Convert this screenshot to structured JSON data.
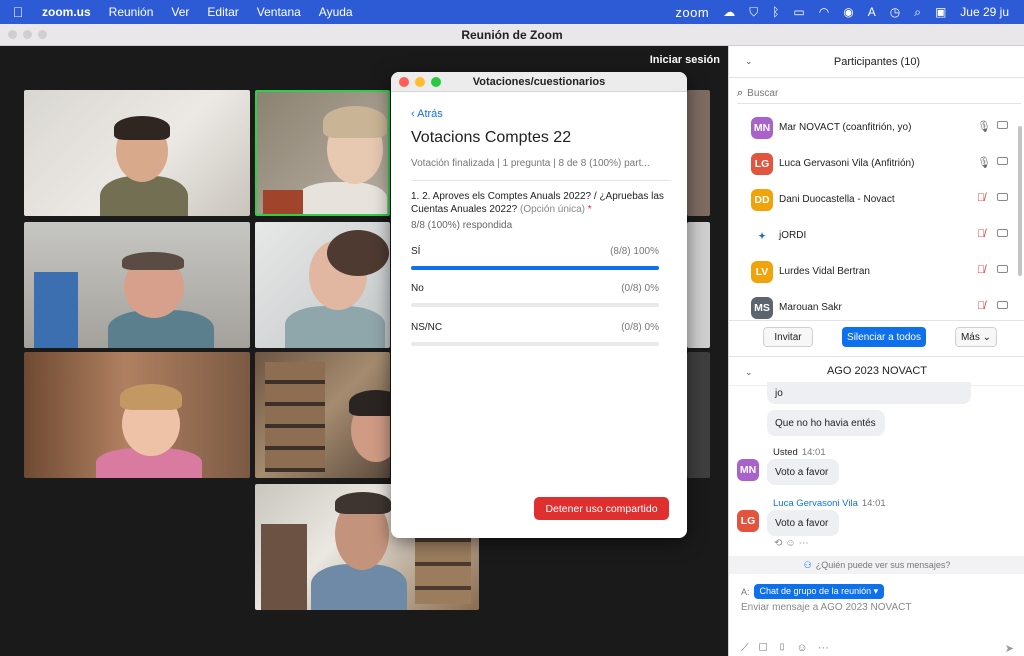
{
  "menubar": {
    "app": "zoom.us",
    "items": [
      "Reunión",
      "Ver",
      "Editar",
      "Ventana",
      "Ayuda"
    ],
    "status_zoom": "zoom",
    "clock": "Jue 29 ju"
  },
  "window": {
    "title": "Reunión de Zoom",
    "signin": "Iniciar sesión"
  },
  "poll": {
    "window_title": "Votaciones/cuestionarios",
    "back": "‹ Atrás",
    "name": "Votacions Comptes 22",
    "meta": "Votación finalizada  |  1 pregunta  |  8 de 8 (100%) part...",
    "question": "1. 2. Aproves els Comptes Anuals 2022? / ¿Apruebas las Cuentas Anuales 2022?",
    "question_type": "(Opción única)",
    "required_mark": "*",
    "answered": "8/8 (100%) respondida",
    "options": [
      {
        "label": "SÍ",
        "result": "(8/8) 100%",
        "fraction": 1.0
      },
      {
        "label": "No",
        "result": "(0/8) 0%",
        "fraction": 0.0
      },
      {
        "label": "NS/NC",
        "result": "(0/8) 0%",
        "fraction": 0.0
      }
    ],
    "stop_button": "Detener uso compartido"
  },
  "participants": {
    "header": "Participantes (10)",
    "search_placeholder": "Buscar",
    "list": [
      {
        "initials": "MN",
        "name": "Mar NOVACT (coanfitrión, yo)",
        "color": "#a862c9",
        "muted": false
      },
      {
        "initials": "LG",
        "name": "Luca Gervasoni Vila (Anfitrión)",
        "color": "#e2543e",
        "muted": false
      },
      {
        "initials": "DD",
        "name": "Dani Duocastella - Novact",
        "color": "#f0a30a",
        "muted": true
      },
      {
        "initials": "",
        "name": "jORDI",
        "color": "#ffffff",
        "muted": true
      },
      {
        "initials": "LV",
        "name": "Lurdes Vidal Bertran",
        "color": "#f0a30a",
        "muted": true
      },
      {
        "initials": "MS",
        "name": "Marouan Sakr",
        "color": "#5c6470",
        "muted": true
      }
    ],
    "invite": "Invitar",
    "mute_all": "Silenciar a todos",
    "more": "Más ⌄"
  },
  "chat": {
    "header": "AGO 2023 NOVACT",
    "msg_top": "jo",
    "msg_prev": "Que no ho havia entés",
    "msg1": {
      "sender": "Usted",
      "time": "14:01",
      "text": "Voto a favor",
      "initials": "MN",
      "color": "#a862c9"
    },
    "msg2": {
      "sender": "Luca Gervasoni Vila",
      "time": "14:01",
      "text": "Voto a favor",
      "initials": "LG",
      "color": "#e2543e"
    },
    "privacy": "¿Quién puede ver sus mensajes?",
    "to_label": "A:",
    "to_value": "Chat de grupo de la reunión ▾",
    "input_placeholder": "Enviar mensaje a AGO 2023 NOVACT"
  }
}
